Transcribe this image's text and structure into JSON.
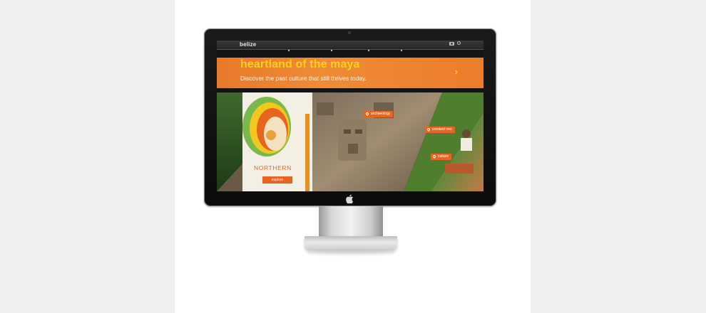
{
  "site": {
    "logo": "belize",
    "nav_icons": [
      "camera-icon",
      "search-icon"
    ]
  },
  "banner": {
    "title": "heartland of the maya",
    "subtitle": "Discover the past culture that still thrives today.",
    "next_arrow": "›"
  },
  "region": {
    "label": "NORTHERN",
    "explore_label": "explore"
  },
  "pins": [
    {
      "label": "archaeology"
    },
    {
      "label": "crooked tree"
    },
    {
      "label": "culture"
    }
  ],
  "colors": {
    "accent_orange": "#e8651f",
    "banner_orange": "#ec7d2b",
    "title_yellow": "#ffd21c",
    "page_gray": "#efefef",
    "card_white": "#ffffff",
    "bezel_black": "#111111"
  }
}
